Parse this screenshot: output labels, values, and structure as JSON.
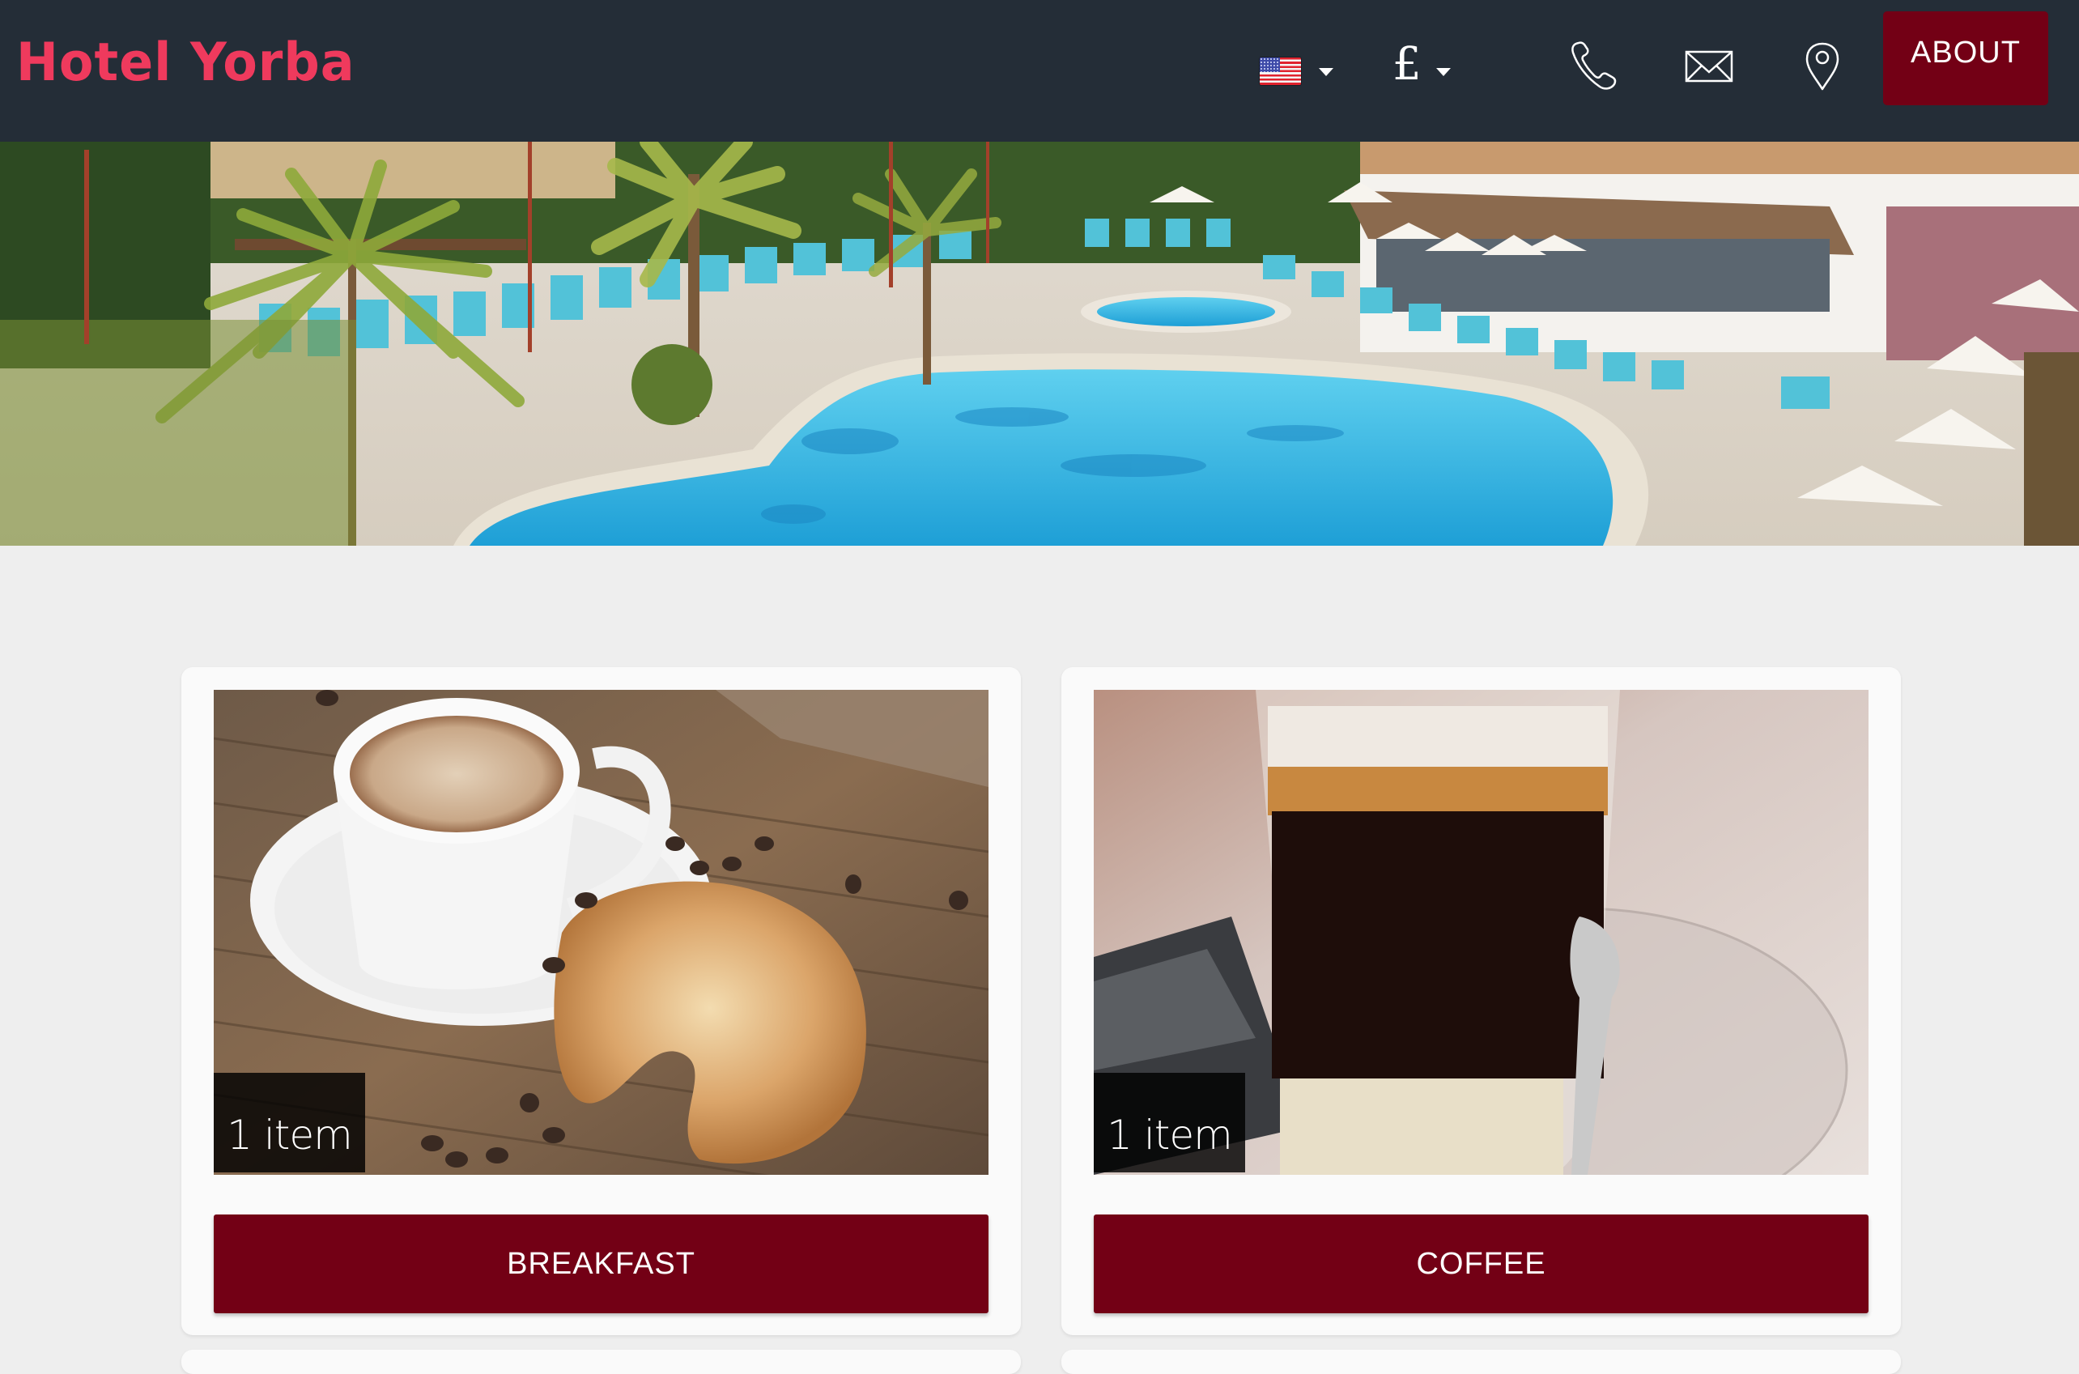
{
  "header": {
    "logo": "Hotel Yorba",
    "language": {
      "selected": "English (US)",
      "icon": "us-flag-icon"
    },
    "currency": {
      "selected": "£",
      "icon": "pound-sign"
    },
    "contact_icons": [
      "phone-icon",
      "mail-icon",
      "map-pin-icon"
    ],
    "about_label": "ABOUT"
  },
  "hero": {
    "alt": "Hotel pool area with sun loungers and palm trees"
  },
  "categories": [
    {
      "label": "BREAKFAST",
      "count": "1 item",
      "image": "Coffee cup with croissant and coffee beans on wooden table"
    },
    {
      "label": "COFFEE",
      "count": "1 item",
      "image": "Layered coffee in glass with spoon on saucer"
    }
  ],
  "colors": {
    "header_bg": "#242d37",
    "logo": "#ef3a5d",
    "accent": "#730015",
    "page_bg": "#eeeeee",
    "card_bg": "#fafafa"
  }
}
